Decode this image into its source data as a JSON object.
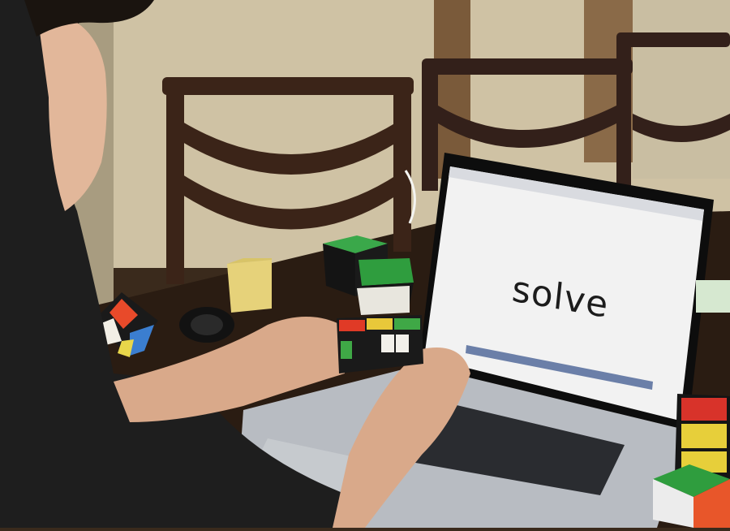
{
  "scene": {
    "description_free": true,
    "colors": {
      "wall": "#cfc2a4",
      "table": "#2a1c12",
      "chair": "#3b2418",
      "laptop_body": "#b8bcc2",
      "screen": "#f2f2f2",
      "hoodie": "#1e1e1e",
      "skin": "#e2b79a"
    },
    "screen_word": "solve"
  }
}
